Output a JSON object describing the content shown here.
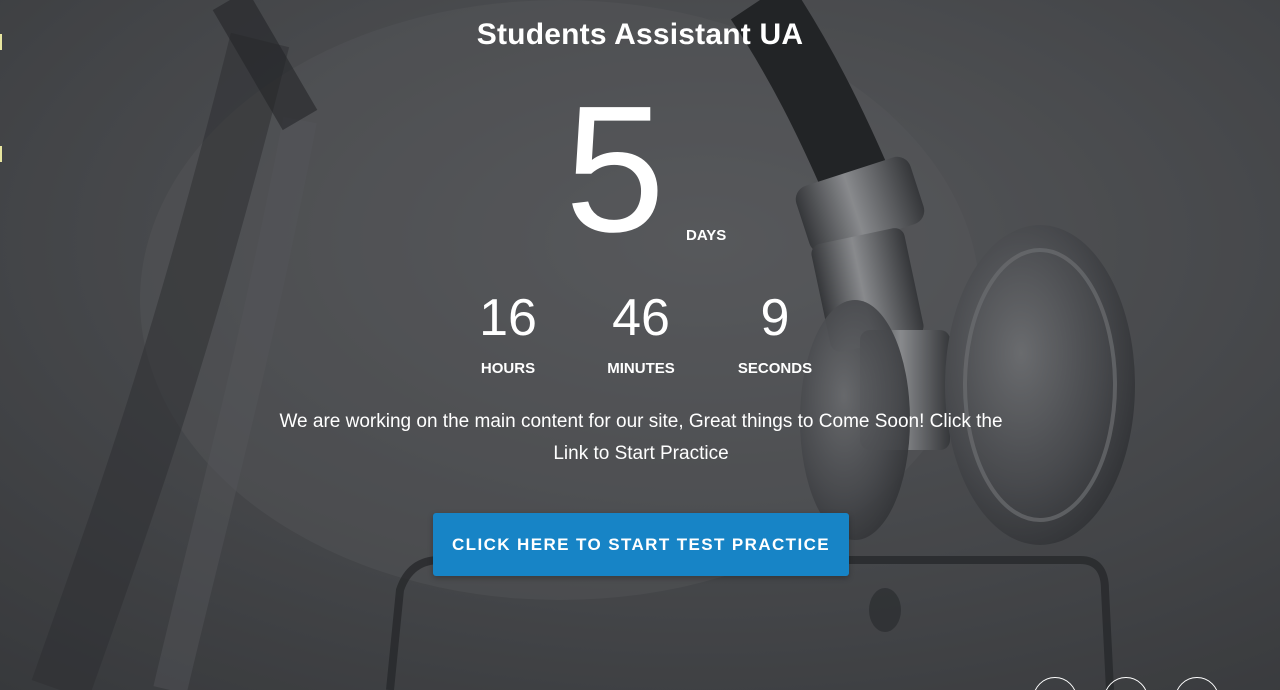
{
  "site": {
    "title": "Students Assistant UA"
  },
  "countdown": {
    "days": {
      "value": "5",
      "label": "DAYS"
    },
    "hours": {
      "value": "16",
      "label": "HOURS"
    },
    "minutes": {
      "value": "46",
      "label": "MINUTES"
    },
    "seconds": {
      "value": "9",
      "label": "SECONDS"
    }
  },
  "message": {
    "text": "We are working on the main content for our site, Great things to Come Soon! Click the Link to Start Practice"
  },
  "cta": {
    "label": "CLICK HERE TO START TEST PRACTICE"
  },
  "social_links": [
    {
      "icon": "social-icon"
    },
    {
      "icon": "social-icon"
    },
    {
      "icon": "social-icon"
    }
  ],
  "colors": {
    "button": "#1784c6",
    "text": "#ffffff",
    "overlay": "#4a4b4e"
  }
}
